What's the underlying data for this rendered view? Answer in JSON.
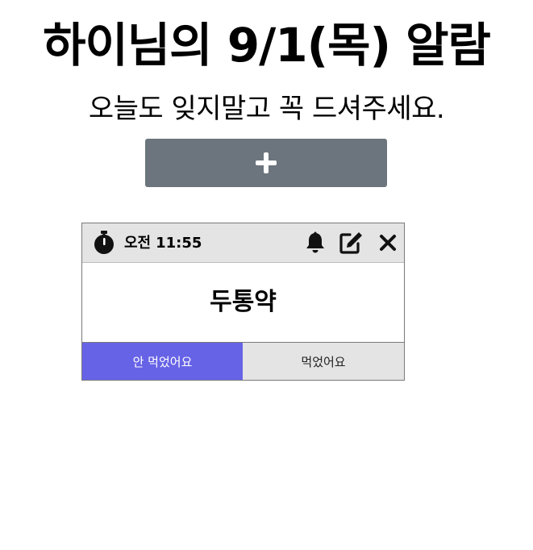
{
  "header": {
    "title": "하이님의 9/1(목) 알람",
    "subtitle": "오늘도 잊지말고 꼭 드셔주세요."
  },
  "add_button": {
    "icon": "plus-icon",
    "color": "#6c757d"
  },
  "alarm_card": {
    "period": "오전",
    "time": "11:55",
    "medicine": "두통약",
    "icons": [
      "stopwatch-icon",
      "bell-icon",
      "edit-icon",
      "close-icon"
    ],
    "status_buttons": {
      "not_taken_label": "안 먹었어요",
      "taken_label": "먹었어요",
      "selected": "not_taken"
    },
    "colors": {
      "header_bg": "#e4e4e4",
      "selected_bg": "#6763e6"
    }
  }
}
